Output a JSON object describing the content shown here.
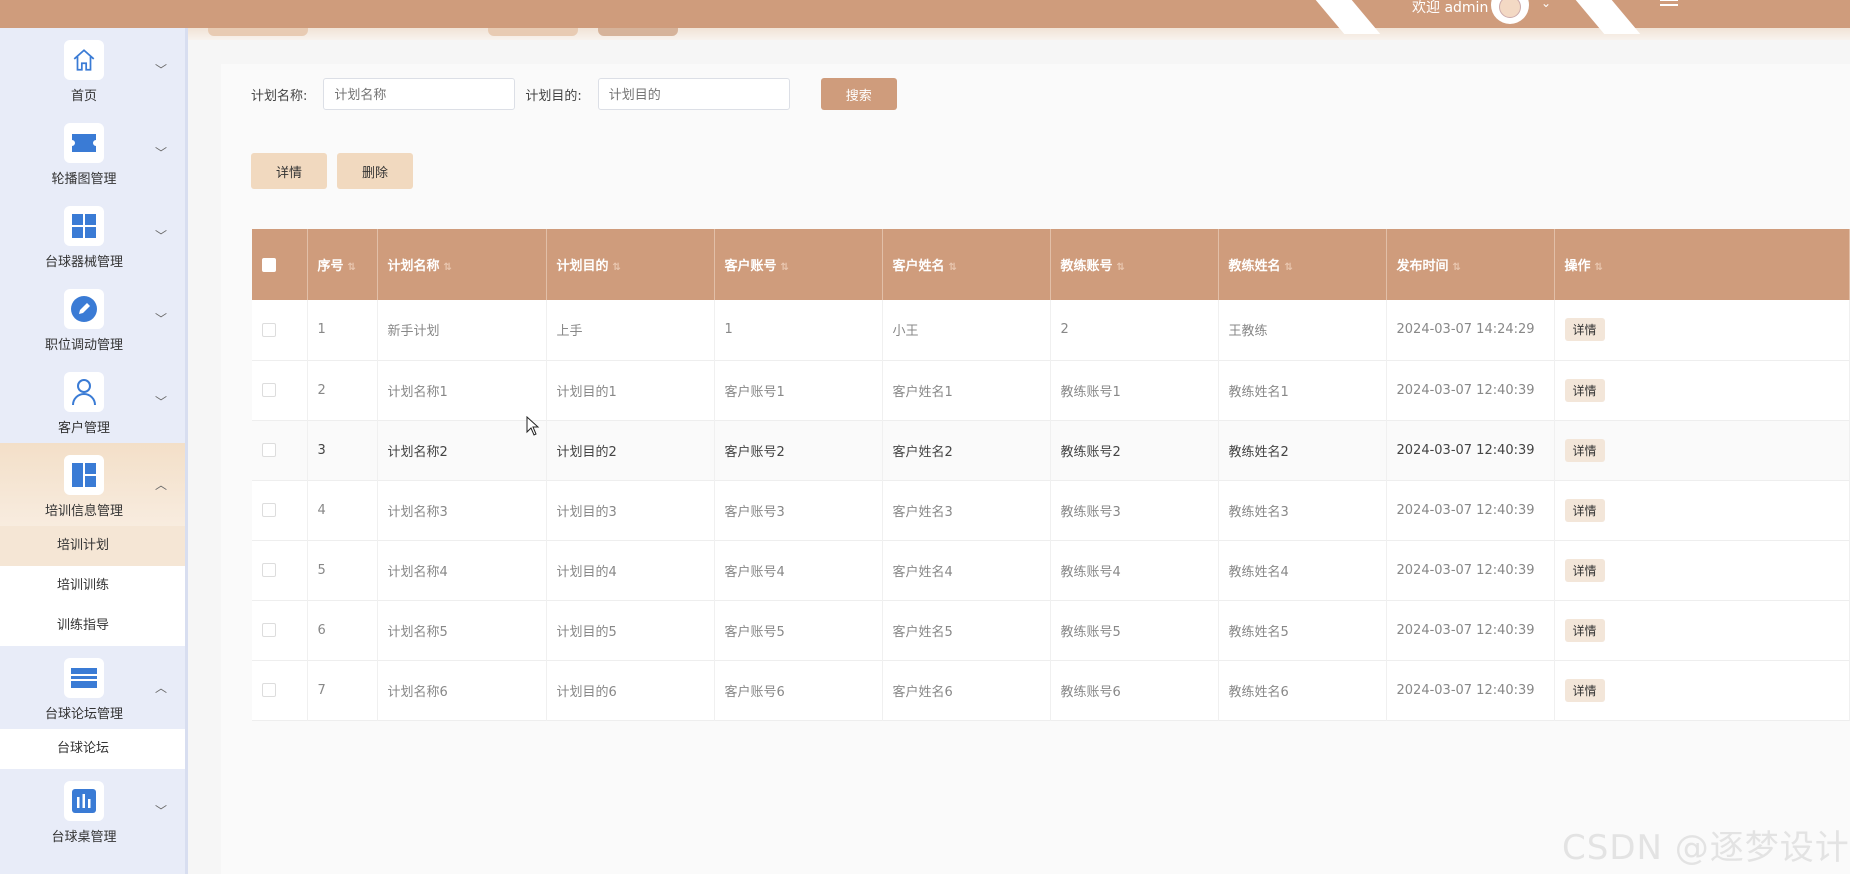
{
  "header": {
    "welcome": "欢迎 admin"
  },
  "sidebar": {
    "groups": [
      {
        "label": "首页",
        "icon": "home-icon",
        "expanded": false
      },
      {
        "label": "轮播图管理",
        "icon": "ticket-icon",
        "expanded": false
      },
      {
        "label": "台球器械管理",
        "icon": "grid-icon",
        "expanded": false
      },
      {
        "label": "职位调动管理",
        "icon": "edit-icon",
        "expanded": false
      },
      {
        "label": "客户管理",
        "icon": "user-icon",
        "expanded": false
      },
      {
        "label": "培训信息管理",
        "icon": "dashboard-icon",
        "expanded": true,
        "items": [
          "培训计划",
          "培训训练",
          "训练指导"
        ]
      },
      {
        "label": "台球论坛管理",
        "icon": "list-icon",
        "expanded": true,
        "items": [
          "台球论坛"
        ]
      },
      {
        "label": "台球桌管理",
        "icon": "chart-icon",
        "expanded": false
      }
    ]
  },
  "search": {
    "plan_name_label": "计划名称:",
    "plan_name_placeholder": "计划名称",
    "plan_purpose_label": "计划目的:",
    "plan_purpose_placeholder": "计划目的",
    "search_button": "搜索"
  },
  "actions": {
    "detail_button": "详情",
    "delete_button": "删除"
  },
  "table": {
    "columns": [
      "序号",
      "计划名称",
      "计划目的",
      "客户账号",
      "客户姓名",
      "教练账号",
      "教练姓名",
      "发布时间",
      "操作"
    ],
    "rows": [
      [
        "1",
        "新手计划",
        "上手",
        "1",
        "小王",
        "2",
        "王教练",
        "2024-03-07 14:24:29"
      ],
      [
        "2",
        "计划名称1",
        "计划目的1",
        "客户账号1",
        "客户姓名1",
        "教练账号1",
        "教练姓名1",
        "2024-03-07 12:40:39"
      ],
      [
        "3",
        "计划名称2",
        "计划目的2",
        "客户账号2",
        "客户姓名2",
        "教练账号2",
        "教练姓名2",
        "2024-03-07 12:40:39"
      ],
      [
        "4",
        "计划名称3",
        "计划目的3",
        "客户账号3",
        "客户姓名3",
        "教练账号3",
        "教练姓名3",
        "2024-03-07 12:40:39"
      ],
      [
        "5",
        "计划名称4",
        "计划目的4",
        "客户账号4",
        "客户姓名4",
        "教练账号4",
        "教练姓名4",
        "2024-03-07 12:40:39"
      ],
      [
        "6",
        "计划名称5",
        "计划目的5",
        "客户账号5",
        "客户姓名5",
        "教练账号5",
        "教练姓名5",
        "2024-03-07 12:40:39"
      ],
      [
        "7",
        "计划名称6",
        "计划目的6",
        "客户账号6",
        "客户姓名6",
        "教练账号6",
        "教练姓名6",
        "2024-03-07 12:40:39"
      ]
    ],
    "row_action": "详情"
  },
  "watermark": "CSDN @逐梦设计",
  "colors": {
    "accent": "#cf9c7c",
    "accent_light": "#f1d9bf",
    "sidebar_bg": "#e8ecf8",
    "icon_blue": "#3a7bd5"
  }
}
